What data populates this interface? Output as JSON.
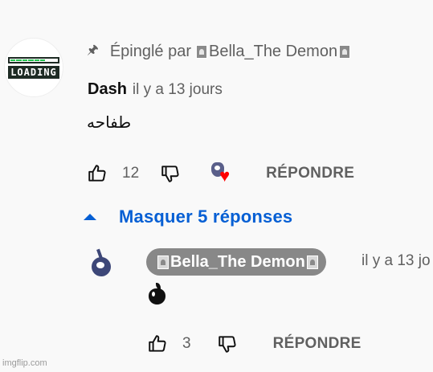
{
  "top_comment": {
    "avatar_text": "LOADING",
    "avatar_icon": "loading-bar-avatar",
    "pinned_prefix": "Épinglé par",
    "pinned_by": "Bella_The Demon",
    "author": "Dash",
    "timestamp": "il y a 13 jours",
    "text": "طفاحه",
    "like_count": "12",
    "reply_label": "RÉPONDRE",
    "creator_heart_color": "#ff0000"
  },
  "replies_toggle": {
    "label": "Masquer 5 réponses",
    "color": "#065fd4"
  },
  "reply": {
    "author": "Bella_The Demon",
    "timestamp": "il y a 13 jo",
    "text_icon": "black-apple-emoji",
    "like_count": "3",
    "reply_label": "RÉPONDRE"
  },
  "watermark": "imgflip.com"
}
